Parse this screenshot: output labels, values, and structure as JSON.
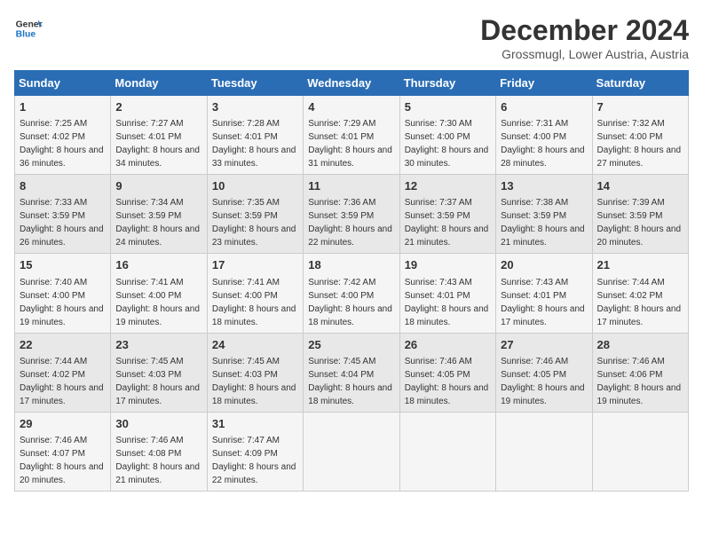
{
  "header": {
    "logo_line1": "General",
    "logo_line2": "Blue",
    "month_title": "December 2024",
    "location": "Grossmugl, Lower Austria, Austria"
  },
  "days_of_week": [
    "Sunday",
    "Monday",
    "Tuesday",
    "Wednesday",
    "Thursday",
    "Friday",
    "Saturday"
  ],
  "weeks": [
    [
      {
        "day": 1,
        "sunrise": "7:25 AM",
        "sunset": "4:02 PM",
        "daylight": "8 hours and 36 minutes."
      },
      {
        "day": 2,
        "sunrise": "7:27 AM",
        "sunset": "4:01 PM",
        "daylight": "8 hours and 34 minutes."
      },
      {
        "day": 3,
        "sunrise": "7:28 AM",
        "sunset": "4:01 PM",
        "daylight": "8 hours and 33 minutes."
      },
      {
        "day": 4,
        "sunrise": "7:29 AM",
        "sunset": "4:01 PM",
        "daylight": "8 hours and 31 minutes."
      },
      {
        "day": 5,
        "sunrise": "7:30 AM",
        "sunset": "4:00 PM",
        "daylight": "8 hours and 30 minutes."
      },
      {
        "day": 6,
        "sunrise": "7:31 AM",
        "sunset": "4:00 PM",
        "daylight": "8 hours and 28 minutes."
      },
      {
        "day": 7,
        "sunrise": "7:32 AM",
        "sunset": "4:00 PM",
        "daylight": "8 hours and 27 minutes."
      }
    ],
    [
      {
        "day": 8,
        "sunrise": "7:33 AM",
        "sunset": "3:59 PM",
        "daylight": "8 hours and 26 minutes."
      },
      {
        "day": 9,
        "sunrise": "7:34 AM",
        "sunset": "3:59 PM",
        "daylight": "8 hours and 24 minutes."
      },
      {
        "day": 10,
        "sunrise": "7:35 AM",
        "sunset": "3:59 PM",
        "daylight": "8 hours and 23 minutes."
      },
      {
        "day": 11,
        "sunrise": "7:36 AM",
        "sunset": "3:59 PM",
        "daylight": "8 hours and 22 minutes."
      },
      {
        "day": 12,
        "sunrise": "7:37 AM",
        "sunset": "3:59 PM",
        "daylight": "8 hours and 21 minutes."
      },
      {
        "day": 13,
        "sunrise": "7:38 AM",
        "sunset": "3:59 PM",
        "daylight": "8 hours and 21 minutes."
      },
      {
        "day": 14,
        "sunrise": "7:39 AM",
        "sunset": "3:59 PM",
        "daylight": "8 hours and 20 minutes."
      }
    ],
    [
      {
        "day": 15,
        "sunrise": "7:40 AM",
        "sunset": "4:00 PM",
        "daylight": "8 hours and 19 minutes."
      },
      {
        "day": 16,
        "sunrise": "7:41 AM",
        "sunset": "4:00 PM",
        "daylight": "8 hours and 19 minutes."
      },
      {
        "day": 17,
        "sunrise": "7:41 AM",
        "sunset": "4:00 PM",
        "daylight": "8 hours and 18 minutes."
      },
      {
        "day": 18,
        "sunrise": "7:42 AM",
        "sunset": "4:00 PM",
        "daylight": "8 hours and 18 minutes."
      },
      {
        "day": 19,
        "sunrise": "7:43 AM",
        "sunset": "4:01 PM",
        "daylight": "8 hours and 18 minutes."
      },
      {
        "day": 20,
        "sunrise": "7:43 AM",
        "sunset": "4:01 PM",
        "daylight": "8 hours and 17 minutes."
      },
      {
        "day": 21,
        "sunrise": "7:44 AM",
        "sunset": "4:02 PM",
        "daylight": "8 hours and 17 minutes."
      }
    ],
    [
      {
        "day": 22,
        "sunrise": "7:44 AM",
        "sunset": "4:02 PM",
        "daylight": "8 hours and 17 minutes."
      },
      {
        "day": 23,
        "sunrise": "7:45 AM",
        "sunset": "4:03 PM",
        "daylight": "8 hours and 17 minutes."
      },
      {
        "day": 24,
        "sunrise": "7:45 AM",
        "sunset": "4:03 PM",
        "daylight": "8 hours and 18 minutes."
      },
      {
        "day": 25,
        "sunrise": "7:45 AM",
        "sunset": "4:04 PM",
        "daylight": "8 hours and 18 minutes."
      },
      {
        "day": 26,
        "sunrise": "7:46 AM",
        "sunset": "4:05 PM",
        "daylight": "8 hours and 18 minutes."
      },
      {
        "day": 27,
        "sunrise": "7:46 AM",
        "sunset": "4:05 PM",
        "daylight": "8 hours and 19 minutes."
      },
      {
        "day": 28,
        "sunrise": "7:46 AM",
        "sunset": "4:06 PM",
        "daylight": "8 hours and 19 minutes."
      }
    ],
    [
      {
        "day": 29,
        "sunrise": "7:46 AM",
        "sunset": "4:07 PM",
        "daylight": "8 hours and 20 minutes."
      },
      {
        "day": 30,
        "sunrise": "7:46 AM",
        "sunset": "4:08 PM",
        "daylight": "8 hours and 21 minutes."
      },
      {
        "day": 31,
        "sunrise": "7:47 AM",
        "sunset": "4:09 PM",
        "daylight": "8 hours and 22 minutes."
      },
      null,
      null,
      null,
      null
    ]
  ]
}
